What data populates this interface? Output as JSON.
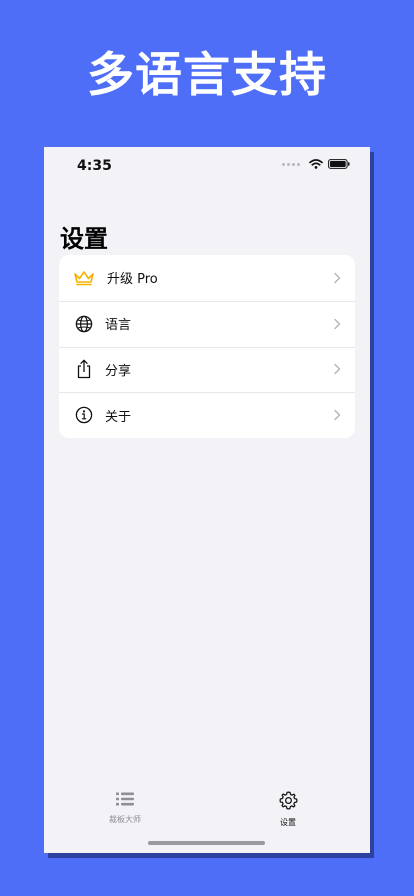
{
  "headline": "多语言支持",
  "status_bar": {
    "time": "4:35"
  },
  "settings": {
    "title": "设置",
    "items": [
      {
        "label": "升级 Pro",
        "icon": "crown-icon"
      },
      {
        "label": "语言",
        "icon": "globe-icon"
      },
      {
        "label": "分享",
        "icon": "share-icon"
      },
      {
        "label": "关于",
        "icon": "info-icon"
      }
    ]
  },
  "tabbar": {
    "items": [
      {
        "label": "裁板大师",
        "icon": "list-icon",
        "active": false
      },
      {
        "label": "设置",
        "icon": "gear-icon",
        "active": true
      }
    ]
  },
  "colors": {
    "background": "#4f6ef7",
    "accent_crown": "#f5b400",
    "screen": "#f2f2f7"
  }
}
